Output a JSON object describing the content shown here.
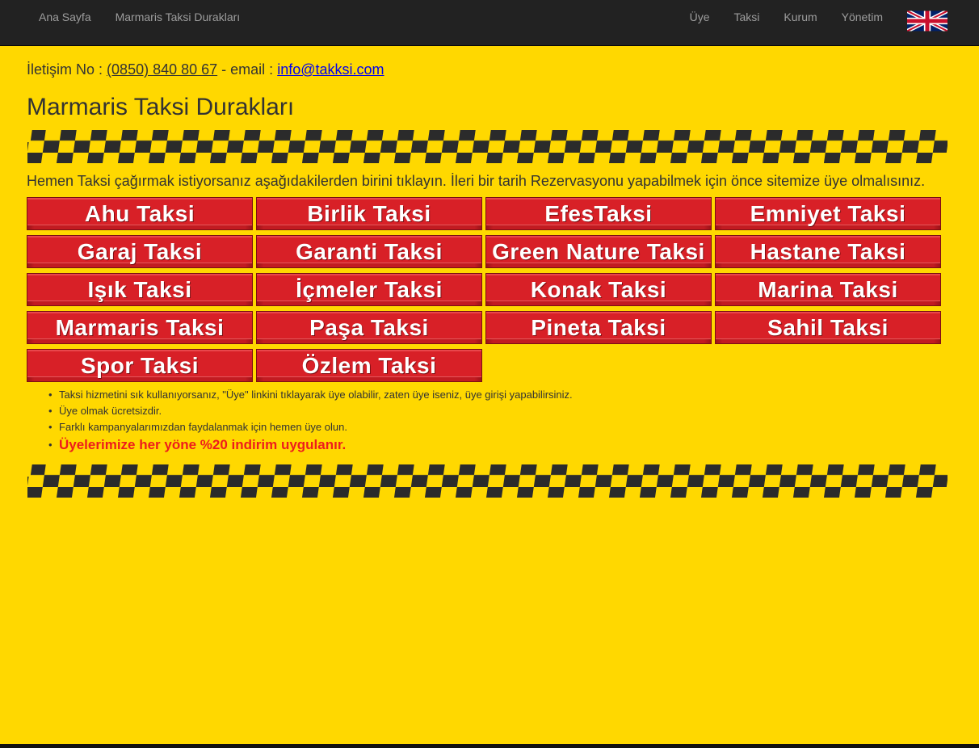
{
  "nav": {
    "left": [
      "Ana Sayfa",
      "Marmaris Taksi Durakları"
    ],
    "right": [
      "Üye",
      "Taksi",
      "Kurum",
      "Yönetim"
    ],
    "flag_icon": "uk-flag-icon"
  },
  "contact": {
    "label": "İletişim No :",
    "phone": "(0850) 840 80 67",
    "separator": "- email :",
    "email": "info@takksi.com"
  },
  "page_title": "Marmaris Taksi Durakları",
  "instructions": "Hemen Taksi çağırmak istiyorsanız aşağıdakilerden birini tıklayın. İleri bir tarih Rezervasyonu yapabilmek için önce sitemize üye olmalısınız.",
  "taxis": [
    "Ahu Taksi",
    "Birlik Taksi",
    "EfesTaksi",
    "Emniyet Taksi",
    "Garaj Taksi",
    "Garanti Taksi",
    "Green Nature Taksi",
    "Hastane Taksi",
    "Işık Taksi",
    "İçmeler Taksi",
    "Konak Taksi",
    "Marina Taksi",
    "Marmaris Taksi",
    "Paşa Taksi",
    "Pineta Taksi",
    "Sahil Taksi",
    "Spor Taksi",
    "Özlem Taksi"
  ],
  "notes": [
    "Taksi hizmetini sık kullanıyorsanız, \"Üye\" linkini tıklayarak üye olabilir, zaten üye iseniz, üye girişi yapabilirsiniz.",
    "Üye olmak ücretsizdir.",
    "Farklı kampanyalarımızdan faydalanmak için hemen üye olun.",
    "Üyelerimize her yöne %20 indirim uygulanır."
  ],
  "colors": {
    "background": "#ffd800",
    "navbar": "#222222",
    "button_red": "#d82027",
    "promo_red": "#ee1c1c"
  }
}
